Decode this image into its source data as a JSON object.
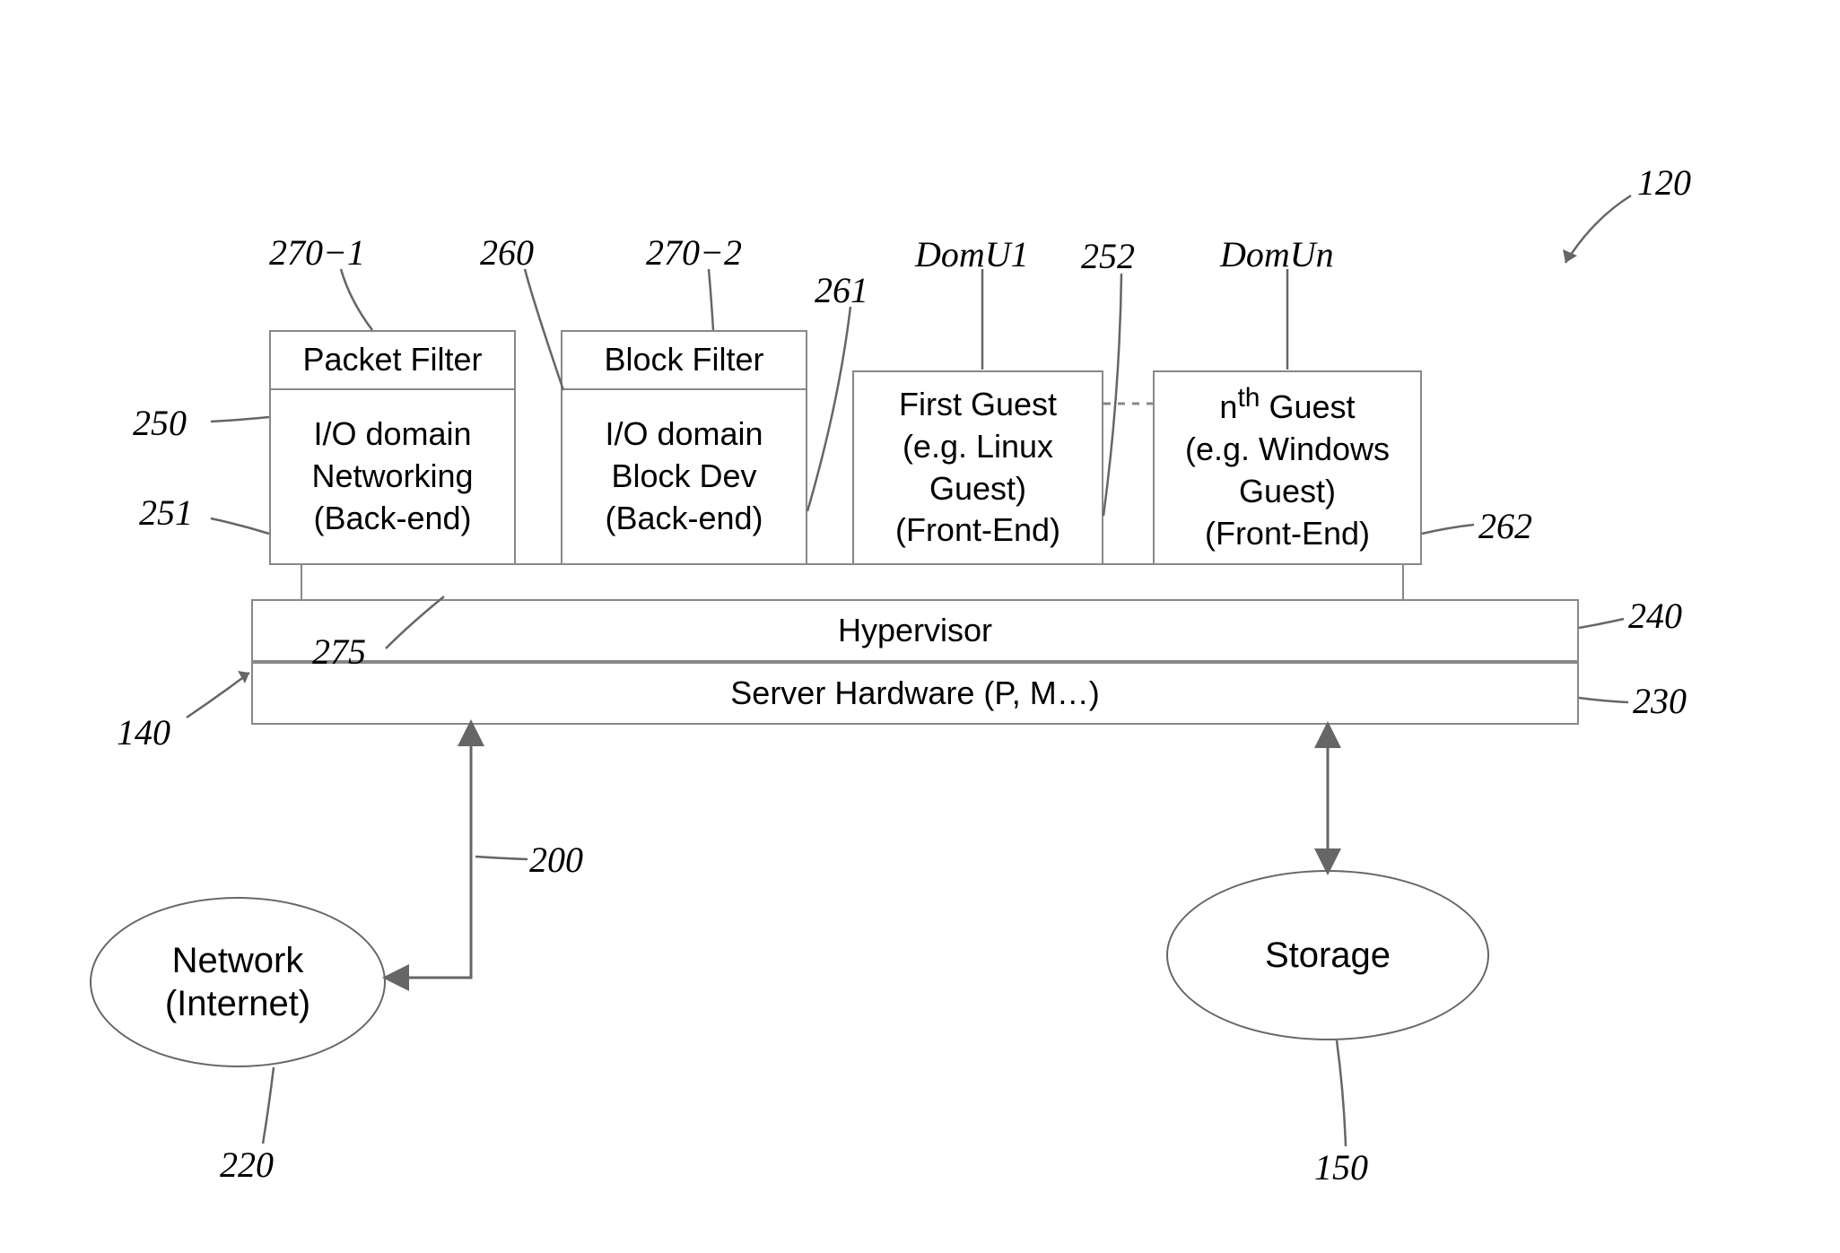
{
  "refs": {
    "r120": "120",
    "r140": "140",
    "r150": "150",
    "r200": "200",
    "r220": "220",
    "r230": "230",
    "r240": "240",
    "r250": "250",
    "r251": "251",
    "r252": "252",
    "r260": "260",
    "r261": "261",
    "r262": "262",
    "r270_1": "270−1",
    "r270_2": "270−2",
    "r275": "275"
  },
  "labels": {
    "domU1": "DomU1",
    "domUn": "DomUn"
  },
  "boxes": {
    "packet_filter": "Packet Filter",
    "io_net": "I/O domain\nNetworking\n(Back-end)",
    "block_filter": "Block Filter",
    "io_block": "I/O domain\nBlock Dev\n(Back-end)",
    "first_guest": "First Guest\n(e.g. Linux\nGuest)\n(Front-End)",
    "nth_guest_html": "n<sup>th</sup> Guest<br>(e.g. Windows<br>Guest)<br>(Front-End)",
    "hypervisor": "Hypervisor",
    "server_hw": "Server Hardware (P, M…)"
  },
  "ellipses": {
    "network": "Network\n(Internet)",
    "storage": "Storage"
  }
}
